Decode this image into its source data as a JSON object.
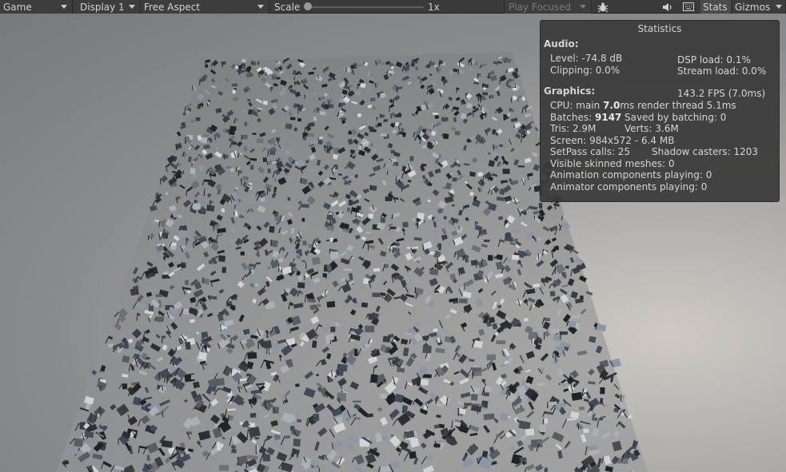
{
  "toolbar": {
    "view_mode": "Game",
    "display": "Display 1",
    "aspect": "Free Aspect",
    "scale_label": "Scale",
    "scale_value": "1x",
    "scale_fraction": 0.0,
    "play_mode": "Play Focused",
    "stats_label": "Stats",
    "gizmos_label": "Gizmos",
    "icons": [
      "bug-icon",
      "speaker-icon",
      "keyboard-icon"
    ]
  },
  "stats": {
    "title": "Statistics",
    "audio_heading": "Audio:",
    "level": "Level: -74.8 dB",
    "clipping": "Clipping: 0.0%",
    "dsp_load": "DSP load: 0.1%",
    "stream_load": "Stream load: 0.0%",
    "graphics_heading": "Graphics:",
    "fps": "143.2 FPS (7.0ms)",
    "cpu_prefix": "CPU: main ",
    "cpu_main": "7.0",
    "cpu_suffix": "ms  render thread 5.1ms",
    "batches_prefix": "Batches: ",
    "batches_value": "9147",
    "saved_by_batching": "Saved by batching: 0",
    "tris": "Tris: 2.9M",
    "verts": "Verts: 3.6M",
    "screen": "Screen: 984x572 - 6.4 MB",
    "setpass": "SetPass calls: 25",
    "shadow_casters": "Shadow casters: 1203",
    "skinned_meshes": "Visible skinned meshes: 0",
    "animation_components": "Animation components playing: 0",
    "animator_components": "Animator components playing: 0"
  },
  "colors": {
    "toolbar_bg": "#3a3a3a",
    "panel_bg": "#3a3a3a",
    "text": "#d4d4d4"
  }
}
